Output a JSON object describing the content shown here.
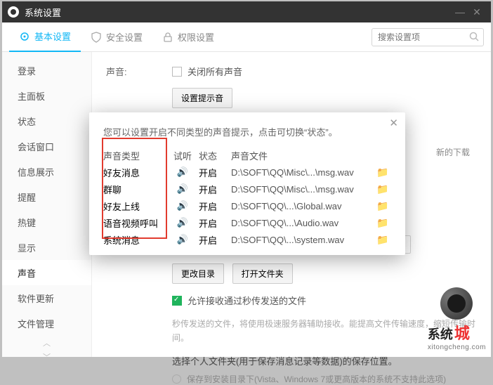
{
  "window": {
    "title": "系统设置"
  },
  "tabs": {
    "basic": "基本设置",
    "security": "安全设置",
    "privilege": "权限设置"
  },
  "search": {
    "placeholder": "搜索设置项"
  },
  "sidebar": {
    "items": [
      "登录",
      "主面板",
      "状态",
      "会话窗口",
      "信息展示",
      "提醒",
      "热键",
      "显示",
      "声音",
      "软件更新",
      "文件管理"
    ]
  },
  "content": {
    "sound_label": "声音:",
    "close_all": "关闭所有声音",
    "set_hint": "设置提示音",
    "new_download": "新的下载",
    "change_dir": "更改目录",
    "open_folder": "打开文件夹",
    "allow_fast": "允许接收通过秒传发送的文件",
    "fast_desc": "秒传发送的文件，将使用极速服务器辅助接收。能提高文件传输速度，缩短传输时间。",
    "choose_folder": "选择个人文件夹(用于保存消息记录等数据)的保存位置。",
    "radio1": "保存到安装目录下(Vista、Windows 7或更高版本的系统不支持此选项)"
  },
  "dialog": {
    "tip": "您可以设置开启不同类型的声音提示，点击可切换“状态”。",
    "headers": {
      "type": "声音类型",
      "listen": "试听",
      "state": "状态",
      "file": "声音文件"
    },
    "rows": [
      {
        "type": "好友消息",
        "state": "开启",
        "file": "D:\\SOFT\\QQ\\Misc\\...\\msg.wav"
      },
      {
        "type": "群聊",
        "state": "开启",
        "file": "D:\\SOFT\\QQ\\Misc\\...\\msg.wav"
      },
      {
        "type": "好友上线",
        "state": "开启",
        "file": "D:\\SOFT\\QQ\\...\\Global.wav"
      },
      {
        "type": "语音视频呼叫",
        "state": "开启",
        "file": "D:\\SOFT\\QQ\\...\\Audio.wav"
      },
      {
        "type": "系统消息",
        "state": "开启",
        "file": "D:\\SOFT\\QQ\\...\\system.wav"
      }
    ]
  },
  "logo": {
    "text1": "系统",
    "text2": "城",
    "url": "xitongcheng.com"
  }
}
